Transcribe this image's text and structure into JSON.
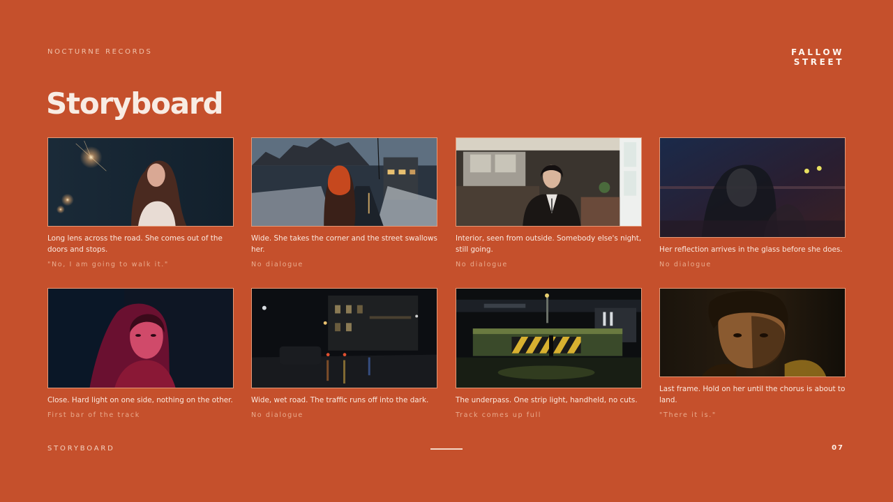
{
  "header": {
    "label": "NOCTURNE RECORDS",
    "logo_line1": "FALLOW",
    "logo_line2": "STREET"
  },
  "title": "Storyboard",
  "frames": [
    {
      "caption": "Long lens across the road. She comes out of the doors and stops.",
      "dialogue": "\"No, I am going to walk it.\""
    },
    {
      "caption": "Wide. She takes the corner and the street swallows her.",
      "dialogue": "No dialogue"
    },
    {
      "caption": "Interior, seen from outside. Somebody else's night, still going.",
      "dialogue": "No dialogue"
    },
    {
      "caption": "Her reflection arrives in the glass before she does.",
      "dialogue": "No dialogue"
    },
    {
      "caption": "Close. Hard light on one side, nothing on the other.",
      "dialogue": "First bar of the track"
    },
    {
      "caption": "Wide, wet road. The traffic runs off into the dark.",
      "dialogue": "No dialogue"
    },
    {
      "caption": "The underpass. One strip light, handheld, no cuts.",
      "dialogue": "Track comes up full"
    },
    {
      "caption": "Last frame. Hold on her until the chorus is about to land.",
      "dialogue": "\"There it is.\""
    }
  ],
  "footer": {
    "label": "STORYBOARD",
    "page": "07"
  }
}
